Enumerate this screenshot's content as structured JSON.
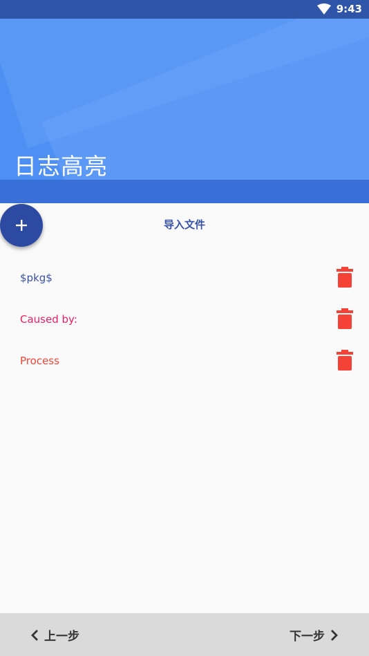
{
  "status_bar": {
    "time": "9:43"
  },
  "header": {
    "title": "日志高亮"
  },
  "import": {
    "label": "导入文件"
  },
  "rules": [
    {
      "text": "$pkg$",
      "color": "#3851a5"
    },
    {
      "text": "Caused by:",
      "color": "#e91e63"
    },
    {
      "text": "Process",
      "color": "#f44336"
    }
  ],
  "colors": {
    "primary": "#4d8ff3",
    "fab": "#2d4aa2",
    "delete": "#f44336"
  },
  "icons": {
    "status": [
      "wifi-icon"
    ],
    "fab": "plus-icon",
    "row_action": "trash-icon",
    "prev": "chevron-left-icon",
    "next": "chevron-right-icon"
  },
  "bottom_nav": {
    "prev": "上一步",
    "next": "下一步"
  }
}
